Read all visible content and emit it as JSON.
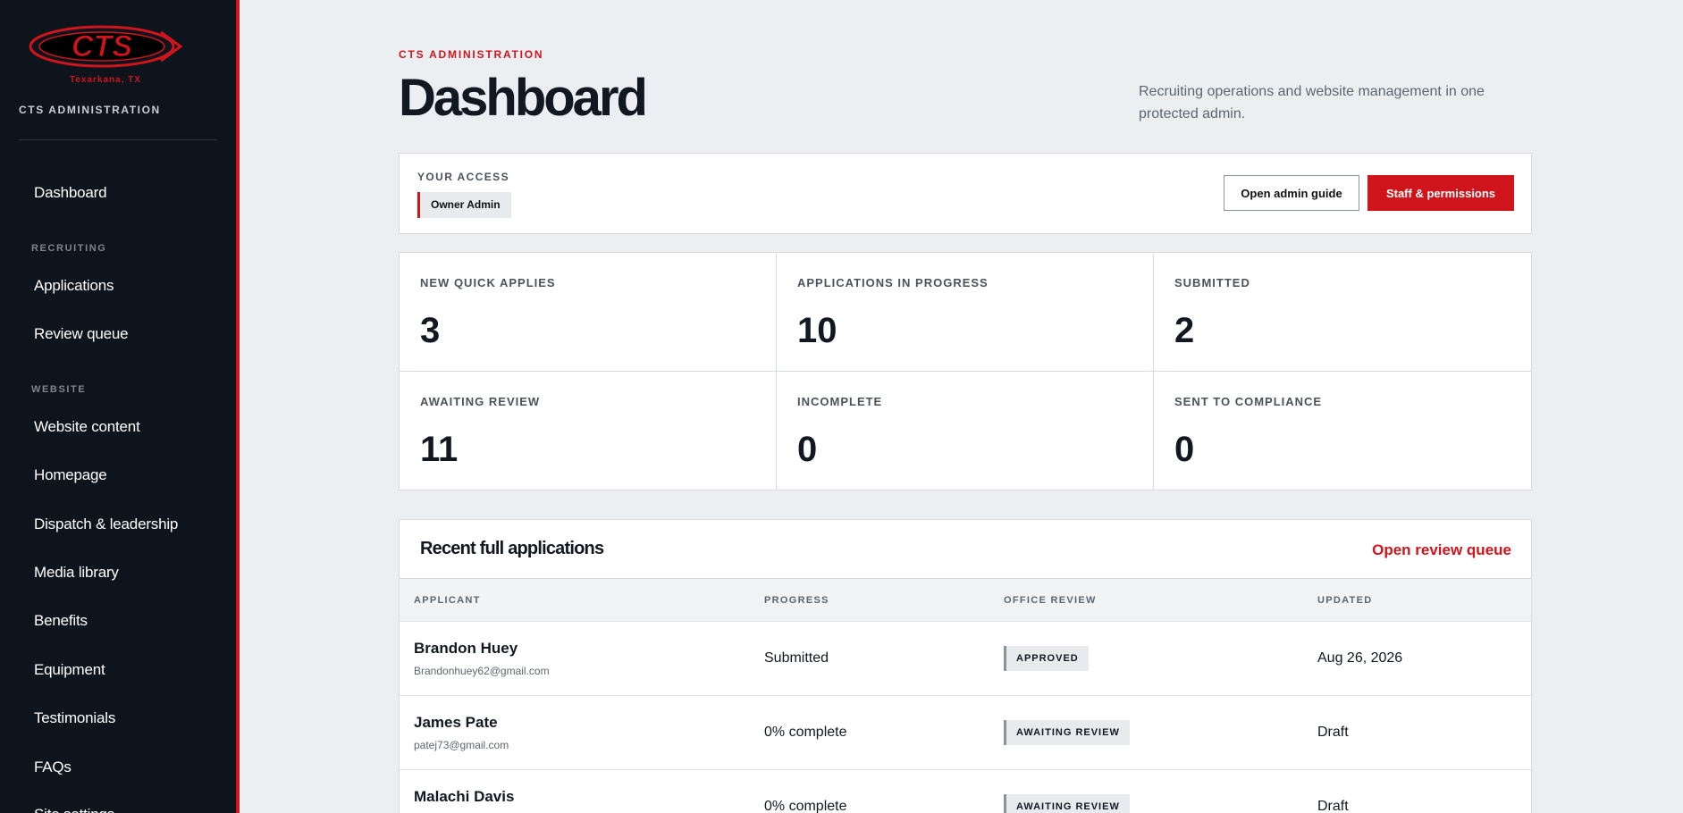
{
  "sidebar": {
    "logo_text": "CTS",
    "logo_tagline": "Texarkana, TX",
    "brand": "CTS ADMINISTRATION",
    "dashboard": "Dashboard",
    "recruiting_label": "RECRUITING",
    "recruiting_items": [
      "Applications",
      "Review queue"
    ],
    "website_label": "WEBSITE",
    "website_items": [
      "Website content",
      "Homepage",
      "Dispatch & leadership",
      "Media library",
      "Benefits",
      "Equipment",
      "Testimonials",
      "FAQs",
      "Site settings"
    ]
  },
  "header": {
    "eyebrow": "CTS ADMINISTRATION",
    "title": "Dashboard",
    "description": "Recruiting operations and website management in one protected admin."
  },
  "access": {
    "label": "YOUR ACCESS",
    "role": "Owner Admin",
    "guide_button": "Open admin guide",
    "staff_button": "Staff & permissions"
  },
  "stats": [
    {
      "label": "NEW QUICK APPLIES",
      "value": "3"
    },
    {
      "label": "APPLICATIONS IN PROGRESS",
      "value": "10"
    },
    {
      "label": "SUBMITTED",
      "value": "2"
    },
    {
      "label": "AWAITING REVIEW",
      "value": "11"
    },
    {
      "label": "INCOMPLETE",
      "value": "0"
    },
    {
      "label": "SENT TO COMPLIANCE",
      "value": "0"
    }
  ],
  "recent": {
    "title": "Recent full applications",
    "link": "Open review queue",
    "columns": [
      "APPLICANT",
      "PROGRESS",
      "OFFICE REVIEW",
      "UPDATED"
    ],
    "rows": [
      {
        "name": "Brandon Huey",
        "email": "Brandonhuey62@gmail.com",
        "progress": "Submitted",
        "review": "APPROVED",
        "updated": "Aug 26, 2026"
      },
      {
        "name": "James Pate",
        "email": "patej73@gmail.com",
        "progress": "0% complete",
        "review": "AWAITING REVIEW",
        "updated": "Draft"
      },
      {
        "name": "Malachi Davis",
        "email": "",
        "progress": "0% complete",
        "review": "AWAITING REVIEW",
        "updated": "Draft"
      }
    ]
  },
  "colors": {
    "accent": "#d0141c",
    "sidebar_bg": "#0d141c",
    "page_bg": "#eceff2"
  }
}
